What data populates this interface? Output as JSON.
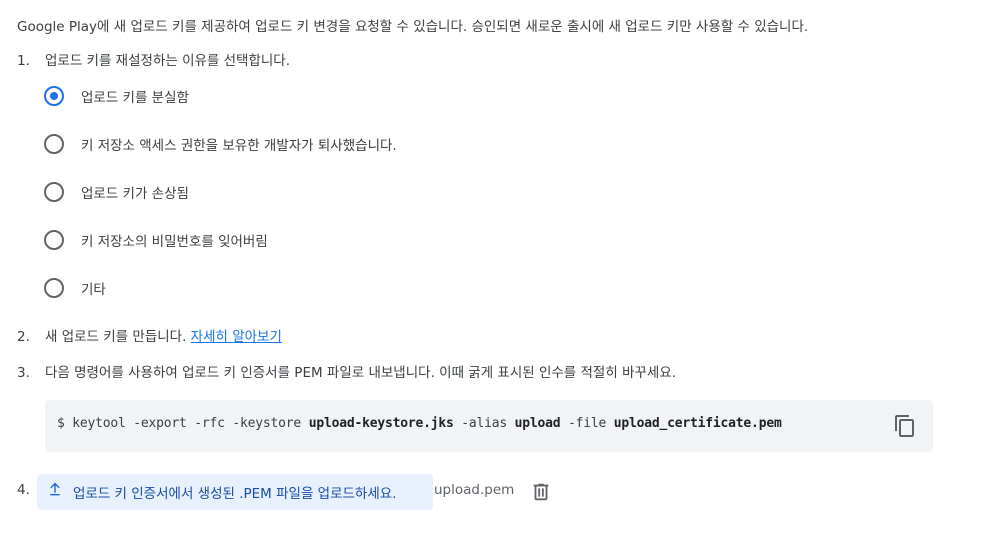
{
  "intro": "Google Play에 새 업로드 키를 제공하여 업로드 키 변경을 요청할 수 있습니다. 승인되면 새로운 출시에 새 업로드 키만 사용할 수 있습니다.",
  "step1": {
    "num": "1.",
    "text": "업로드 키를 재설정하는 이유를 선택합니다.",
    "options": [
      {
        "label": "업로드 키를 분실함",
        "checked": true
      },
      {
        "label": "키 저장소 액세스 권한을 보유한 개발자가 퇴사했습니다.",
        "checked": false
      },
      {
        "label": "업로드 키가 손상됨",
        "checked": false
      },
      {
        "label": "키 저장소의 비밀번호를 잊어버림",
        "checked": false
      },
      {
        "label": "기타",
        "checked": false
      }
    ]
  },
  "step2": {
    "num": "2.",
    "text": "새 업로드 키를 만듭니다. ",
    "link": "자세히 알아보기"
  },
  "step3": {
    "num": "3.",
    "text": "다음 명령어를 사용하여 업로드 키 인증서를 PEM 파일로 내보냅니다. 이때 굵게 표시된 인수를 적절히 바꾸세요.",
    "command": {
      "p1": "$ keytool -export -rfc -keystore ",
      "b1": "upload-keystore.jks",
      "p2": " -alias ",
      "b2": "upload",
      "p3": " -file ",
      "b3": "upload_certificate.pem"
    }
  },
  "step4": {
    "num": "4.",
    "upload_label": "업로드 키 인증서에서 생성된 .PEM 파일을 업로드하세요.",
    "file_name": "upload.pem"
  },
  "icons": {
    "copy": "copy-icon",
    "upload": "upload-icon",
    "delete": "trash-icon"
  },
  "colors": {
    "accent": "#1a73e8",
    "code_bg": "#f1f3f4",
    "upload_bg": "#e8f0fe"
  }
}
